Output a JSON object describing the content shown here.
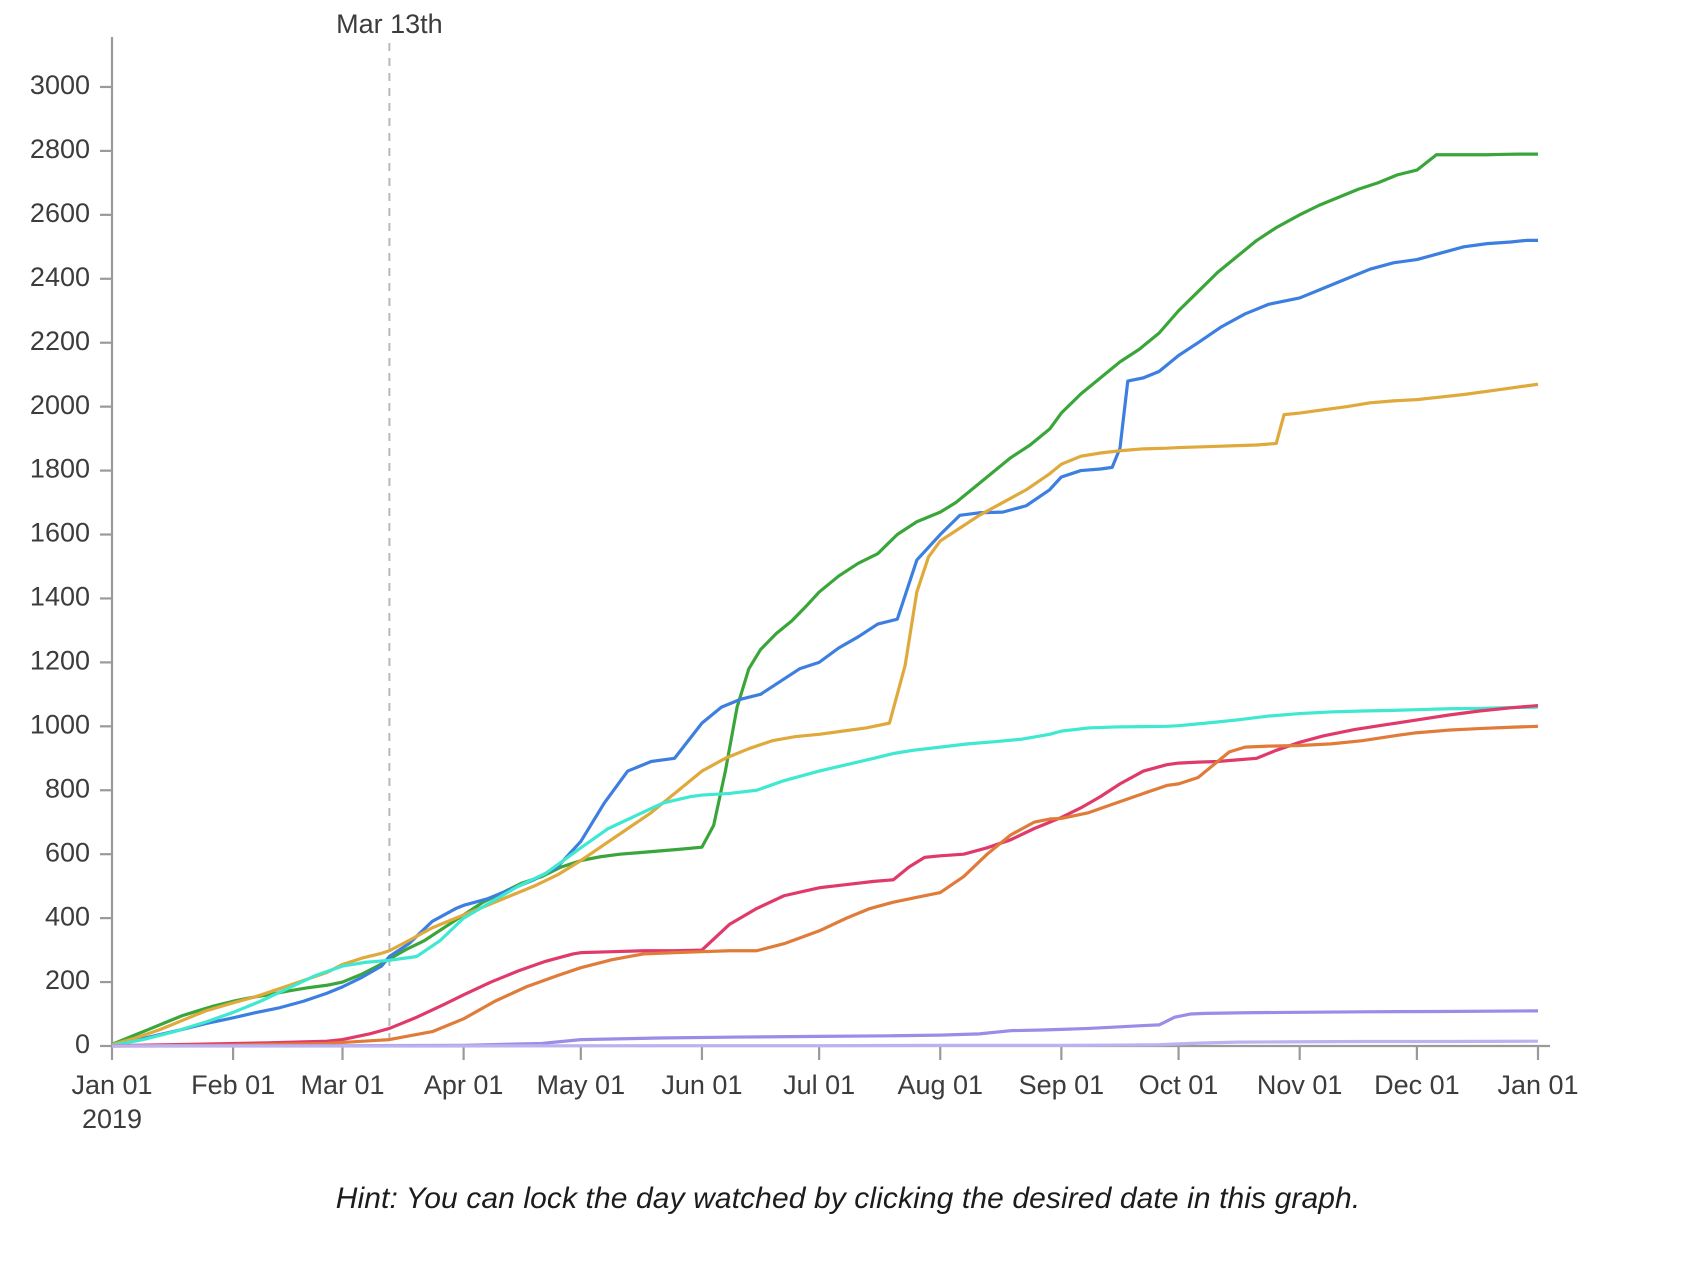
{
  "hint": {
    "text": "Hint: You can lock the day watched by clicking the desired date in this graph."
  },
  "annotation": {
    "label": "Mar 13th",
    "x_value": 71
  },
  "chart_data": {
    "type": "line",
    "title": "",
    "subtitle": "",
    "xlabel": "",
    "ylabel": "",
    "xlim": [
      0,
      365
    ],
    "ylim": [
      0,
      3100
    ],
    "grid": false,
    "legend": "none",
    "y_ticks": [
      0,
      200,
      400,
      600,
      800,
      1000,
      1200,
      1400,
      1600,
      1800,
      2000,
      2200,
      2400,
      2600,
      2800,
      3000
    ],
    "x_ticks": [
      {
        "label": "Jan 01",
        "sublabel": "2019",
        "day": 0
      },
      {
        "label": "Feb 01",
        "sublabel": "",
        "day": 31
      },
      {
        "label": "Mar 01",
        "sublabel": "",
        "day": 59
      },
      {
        "label": "Apr 01",
        "sublabel": "",
        "day": 90
      },
      {
        "label": "May 01",
        "sublabel": "",
        "day": 120
      },
      {
        "label": "Jun 01",
        "sublabel": "",
        "day": 151
      },
      {
        "label": "Jul 01",
        "sublabel": "",
        "day": 181
      },
      {
        "label": "Aug 01",
        "sublabel": "",
        "day": 212
      },
      {
        "label": "Sep 01",
        "sublabel": "",
        "day": 243
      },
      {
        "label": "Oct 01",
        "sublabel": "",
        "day": 273
      },
      {
        "label": "Nov 01",
        "sublabel": "",
        "day": 304
      },
      {
        "label": "Dec 01",
        "sublabel": "",
        "day": 334
      },
      {
        "label": "Jan 01",
        "sublabel": "",
        "day": 365
      }
    ],
    "annotations": [
      {
        "label": "Mar 13th",
        "day": 71,
        "style": "dashed-vline"
      }
    ],
    "series": [
      {
        "name": "series-green",
        "color": "#3aa63a",
        "final_value": 2790,
        "x": [
          0,
          5,
          10,
          14,
          18,
          22,
          26,
          31,
          35,
          40,
          45,
          50,
          55,
          59,
          64,
          68,
          71,
          75,
          80,
          85,
          90,
          95,
          100,
          105,
          110,
          115,
          120,
          125,
          130,
          135,
          140,
          145,
          151,
          154,
          157,
          160,
          163,
          166,
          170,
          174,
          178,
          181,
          186,
          191,
          196,
          201,
          206,
          212,
          216,
          220,
          225,
          230,
          235,
          240,
          243,
          248,
          253,
          258,
          263,
          268,
          273,
          278,
          283,
          288,
          293,
          298,
          304,
          309,
          314,
          319,
          324,
          329,
          334,
          339,
          344,
          349,
          352,
          355,
          360,
          365
        ],
        "y": [
          5,
          30,
          55,
          75,
          95,
          110,
          125,
          140,
          150,
          160,
          172,
          182,
          190,
          200,
          225,
          250,
          272,
          300,
          330,
          370,
          410,
          450,
          480,
          510,
          530,
          560,
          580,
          592,
          600,
          605,
          610,
          615,
          622,
          690,
          860,
          1060,
          1180,
          1240,
          1290,
          1330,
          1380,
          1420,
          1470,
          1510,
          1540,
          1600,
          1640,
          1670,
          1700,
          1740,
          1790,
          1840,
          1880,
          1930,
          1980,
          2040,
          2090,
          2140,
          2180,
          2230,
          2300,
          2360,
          2420,
          2470,
          2520,
          2560,
          2600,
          2630,
          2655,
          2680,
          2700,
          2725,
          2740,
          2788,
          2788,
          2788,
          2788,
          2789,
          2790,
          2790
        ]
      },
      {
        "name": "series-blue",
        "color": "#3d7fe0",
        "final_value": 2520,
        "x": [
          0,
          6,
          12,
          18,
          24,
          31,
          37,
          43,
          49,
          55,
          59,
          64,
          69,
          71,
          76,
          82,
          88,
          90,
          96,
          102,
          108,
          114,
          120,
          126,
          132,
          138,
          144,
          151,
          156,
          161,
          166,
          171,
          176,
          181,
          186,
          191,
          196,
          201,
          206,
          212,
          217,
          222,
          228,
          234,
          240,
          243,
          248,
          253,
          256,
          258,
          260,
          262,
          264,
          268,
          273,
          278,
          284,
          290,
          296,
          304,
          310,
          316,
          322,
          328,
          334,
          340,
          346,
          352,
          358,
          362,
          365
        ],
        "y": [
          3,
          18,
          35,
          52,
          70,
          88,
          105,
          120,
          140,
          165,
          185,
          215,
          250,
          280,
          320,
          390,
          430,
          440,
          460,
          490,
          520,
          560,
          640,
          760,
          860,
          890,
          900,
          1010,
          1060,
          1085,
          1100,
          1140,
          1180,
          1200,
          1245,
          1280,
          1320,
          1335,
          1520,
          1600,
          1660,
          1668,
          1670,
          1690,
          1740,
          1780,
          1800,
          1805,
          1810,
          1870,
          2080,
          2085,
          2090,
          2110,
          2160,
          2200,
          2250,
          2290,
          2320,
          2340,
          2370,
          2400,
          2430,
          2450,
          2460,
          2480,
          2500,
          2510,
          2515,
          2520,
          2520
        ]
      },
      {
        "name": "series-gold",
        "color": "#dfa93c",
        "final_value": 2070,
        "x": [
          0,
          6,
          12,
          18,
          24,
          31,
          37,
          43,
          49,
          55,
          59,
          64,
          69,
          71,
          76,
          82,
          88,
          90,
          96,
          102,
          108,
          114,
          120,
          126,
          132,
          138,
          144,
          151,
          157,
          163,
          169,
          175,
          181,
          187,
          193,
          199,
          203,
          206,
          209,
          212,
          217,
          222,
          228,
          234,
          240,
          243,
          248,
          253,
          258,
          264,
          270,
          273,
          278,
          283,
          288,
          293,
          298,
          300,
          304,
          310,
          316,
          322,
          328,
          334,
          340,
          346,
          352,
          358,
          362,
          365
        ],
        "y": [
          4,
          25,
          50,
          80,
          110,
          135,
          155,
          180,
          205,
          230,
          255,
          275,
          290,
          298,
          330,
          370,
          400,
          410,
          440,
          470,
          500,
          535,
          580,
          630,
          680,
          730,
          790,
          860,
          900,
          930,
          955,
          968,
          975,
          985,
          995,
          1010,
          1190,
          1420,
          1530,
          1580,
          1620,
          1660,
          1700,
          1740,
          1790,
          1820,
          1845,
          1855,
          1862,
          1868,
          1870,
          1872,
          1874,
          1876,
          1878,
          1880,
          1885,
          1975,
          1980,
          1990,
          2000,
          2012,
          2018,
          2022,
          2030,
          2038,
          2048,
          2058,
          2065,
          2070,
          2072
        ]
      },
      {
        "name": "series-cyan",
        "color": "#3fe8d0",
        "final_value": 1060,
        "x": [
          0,
          8,
          16,
          24,
          31,
          38,
          45,
          52,
          59,
          65,
          71,
          78,
          84,
          90,
          97,
          104,
          111,
          120,
          127,
          134,
          141,
          148,
          151,
          158,
          165,
          172,
          181,
          188,
          195,
          200,
          205,
          212,
          219,
          226,
          233,
          240,
          243,
          250,
          257,
          264,
          270,
          273,
          280,
          288,
          296,
          304,
          312,
          320,
          328,
          334,
          342,
          350,
          356,
          360,
          365
        ],
        "y": [
          2,
          20,
          45,
          75,
          105,
          140,
          180,
          220,
          250,
          262,
          268,
          280,
          330,
          400,
          450,
          500,
          540,
          620,
          680,
          720,
          760,
          780,
          785,
          790,
          800,
          830,
          860,
          880,
          900,
          915,
          925,
          935,
          945,
          952,
          960,
          975,
          985,
          995,
          998,
          999,
          1000,
          1002,
          1010,
          1020,
          1032,
          1040,
          1045,
          1048,
          1050,
          1052,
          1055,
          1056,
          1058,
          1059,
          1060
        ]
      },
      {
        "name": "series-crimson",
        "color": "#e03a6b",
        "final_value": 1065,
        "x": [
          0,
          20,
          40,
          55,
          59,
          66,
          71,
          78,
          85,
          90,
          97,
          104,
          111,
          118,
          120,
          128,
          136,
          144,
          151,
          158,
          165,
          172,
          181,
          188,
          195,
          200,
          204,
          208,
          212,
          218,
          224,
          230,
          236,
          240,
          243,
          248,
          253,
          258,
          264,
          270,
          273,
          278,
          283,
          288,
          293,
          298,
          304,
          310,
          318,
          326,
          334,
          342,
          350,
          358,
          365
        ],
        "y": [
          1,
          5,
          10,
          15,
          20,
          38,
          55,
          90,
          130,
          160,
          200,
          235,
          265,
          288,
          292,
          295,
          298,
          298,
          300,
          380,
          430,
          470,
          495,
          505,
          515,
          520,
          560,
          590,
          595,
          600,
          620,
          645,
          680,
          700,
          715,
          745,
          780,
          820,
          860,
          880,
          885,
          888,
          890,
          895,
          900,
          925,
          950,
          970,
          990,
          1005,
          1020,
          1035,
          1048,
          1058,
          1065
        ]
      },
      {
        "name": "series-orange",
        "color": "#e07b3a",
        "final_value": 1000,
        "x": [
          0,
          30,
          55,
          71,
          82,
          90,
          98,
          106,
          114,
          120,
          128,
          136,
          144,
          151,
          158,
          165,
          172,
          181,
          188,
          194,
          200,
          206,
          212,
          218,
          224,
          230,
          236,
          240,
          243,
          250,
          257,
          264,
          270,
          273,
          278,
          282,
          286,
          290,
          296,
          304,
          312,
          320,
          328,
          334,
          342,
          350,
          358,
          365
        ],
        "y": [
          0,
          3,
          8,
          20,
          45,
          85,
          140,
          185,
          220,
          245,
          270,
          288,
          292,
          295,
          298,
          298,
          320,
          360,
          400,
          430,
          450,
          465,
          480,
          530,
          600,
          660,
          700,
          710,
          712,
          730,
          760,
          790,
          815,
          820,
          840,
          880,
          920,
          935,
          938,
          940,
          945,
          955,
          970,
          980,
          988,
          993,
          997,
          1000
        ]
      },
      {
        "name": "series-purple",
        "color": "#9b8ce8",
        "final_value": 110,
        "x": [
          0,
          60,
          90,
          110,
          120,
          140,
          160,
          181,
          200,
          212,
          222,
          230,
          238,
          243,
          250,
          258,
          264,
          268,
          272,
          276,
          280,
          290,
          300,
          320,
          340,
          365
        ],
        "y": [
          0,
          1,
          2,
          8,
          20,
          25,
          28,
          30,
          32,
          34,
          38,
          48,
          50,
          52,
          55,
          60,
          64,
          66,
          90,
          100,
          102,
          104,
          105,
          107,
          108,
          110
        ]
      },
      {
        "name": "series-lavender",
        "color": "#bdb2f0",
        "final_value": 15,
        "x": [
          0,
          80,
          140,
          181,
          212,
          243,
          258,
          268,
          278,
          288,
          300,
          320,
          340,
          365
        ],
        "y": [
          0,
          0,
          1,
          1,
          2,
          2,
          3,
          4,
          9,
          12,
          13,
          14,
          14,
          15
        ]
      }
    ]
  }
}
